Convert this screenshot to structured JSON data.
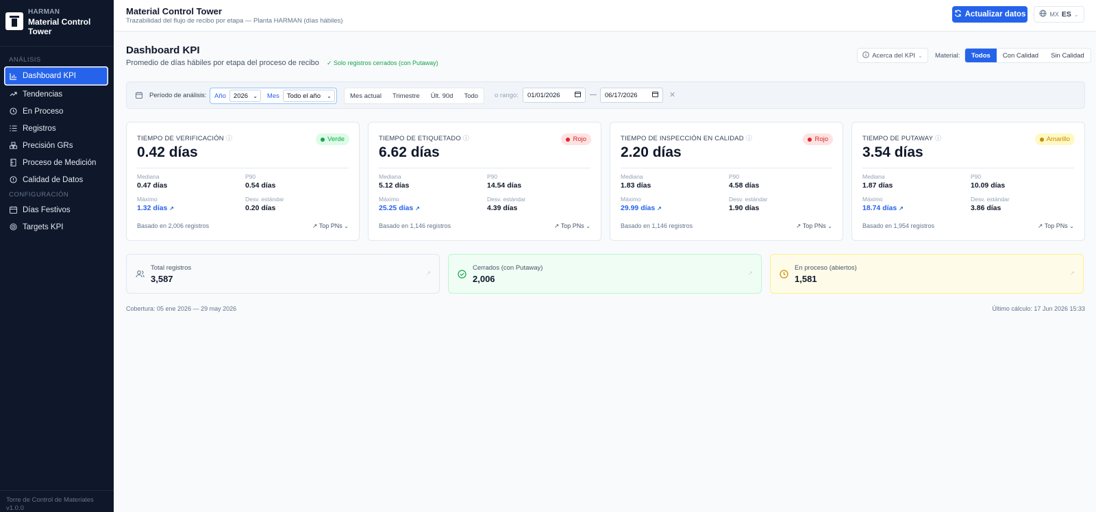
{
  "sidebar": {
    "org": "HARMAN",
    "app_line1": "Material Control",
    "app_line2": "Tower",
    "section_analysis": "ANÁLISIS",
    "section_config": "CONFIGURACIÓN",
    "items": [
      {
        "label": "Dashboard KPI",
        "icon": "bar-chart-icon"
      },
      {
        "label": "Tendencias",
        "icon": "trend-icon"
      },
      {
        "label": "En Proceso",
        "icon": "clock-icon"
      },
      {
        "label": "Registros",
        "icon": "list-icon"
      },
      {
        "label": "Precisión GRs",
        "icon": "boxes-icon"
      },
      {
        "label": "Proceso de Medición",
        "icon": "ruler-icon"
      },
      {
        "label": "Calidad de Datos",
        "icon": "alert-circle-icon"
      },
      {
        "label": "Días Festivos",
        "icon": "calendar-icon"
      },
      {
        "label": "Targets KPI",
        "icon": "target-icon"
      }
    ],
    "footer_line1": "Torre de Control de Materiales",
    "footer_line2": "v1.0.0"
  },
  "topbar": {
    "title": "Material Control Tower",
    "subtitle": "Trazabilidad del flujo de recibo por etapa — Planta HARMAN (días hábiles)",
    "refresh_label": "Actualizar datos",
    "lang_region": "MX",
    "lang_code": "ES"
  },
  "page": {
    "title": "Dashboard KPI",
    "subtitle": "Promedio de días hábiles por etapa del proceso de recibo",
    "closed_note": "✓ Solo registros cerrados (con Putaway)",
    "about_label": "Acerca del KPI",
    "material_label": "Material:",
    "material_options": [
      "Todos",
      "Con Calidad",
      "Sin Calidad"
    ]
  },
  "filter": {
    "period_label": "Período de análisis:",
    "year_label": "Año",
    "year_value": "2026",
    "month_label": "Mes",
    "month_value": "Todo el año",
    "quick_options": [
      "Mes actual",
      "Trimestre",
      "Últ. 90d",
      "Todo"
    ],
    "range_label": "o rango:",
    "date_from": "01/01/2026",
    "date_to": "06/17/2026",
    "range_sep": "—"
  },
  "kpis": [
    {
      "title": "TIEMPO DE VERIFICACIÓN",
      "value": "0.42 días",
      "status": "Verde",
      "status_color": "#16a34a",
      "status_bg": "#dcfce7",
      "median_label": "Mediana",
      "median": "0.47 días",
      "p90_label": "P90",
      "p90": "0.54 días",
      "max_label": "Máximo",
      "max": "1.32 días",
      "std_label": "Desv. estándar",
      "std": "0.20 días",
      "basis": "Basado en 2,006 registros",
      "top_label": "Top PNs"
    },
    {
      "title": "TIEMPO DE ETIQUETADO",
      "value": "6.62 días",
      "status": "Rojo",
      "status_color": "#dc2626",
      "status_bg": "#fee2e2",
      "median_label": "Mediana",
      "median": "5.12 días",
      "p90_label": "P90",
      "p90": "14.54 días",
      "max_label": "Máximo",
      "max": "25.25 días",
      "std_label": "Desv. estándar",
      "std": "4.39 días",
      "basis": "Basado en 1,146 registros",
      "top_label": "Top PNs"
    },
    {
      "title": "TIEMPO DE INSPECCIÓN EN CALIDAD",
      "value": "2.20 días",
      "status": "Rojo",
      "status_color": "#dc2626",
      "status_bg": "#fee2e2",
      "median_label": "Mediana",
      "median": "1.83 días",
      "p90_label": "P90",
      "p90": "4.58 días",
      "max_label": "Máximo",
      "max": "29.99 días",
      "std_label": "Desv. estándar",
      "std": "1.90 días",
      "basis": "Basado en 1,146 registros",
      "top_label": "Top PNs"
    },
    {
      "title": "TIEMPO DE PUTAWAY",
      "value": "3.54 días",
      "status": "Amarillo",
      "status_color": "#ca8a04",
      "status_bg": "#fef9c3",
      "median_label": "Mediana",
      "median": "1.87 días",
      "p90_label": "P90",
      "p90": "10.09 días",
      "max_label": "Máximo",
      "max": "18.74 días",
      "std_label": "Desv. estándar",
      "std": "3.86 días",
      "basis": "Basado en 1,954 registros",
      "top_label": "Top PNs"
    }
  ],
  "summary": [
    {
      "label": "Total registros",
      "value": "3,587",
      "icon": "users-icon",
      "color": "#64748b",
      "bg": "#f8fafc",
      "border": "#e2e8f0"
    },
    {
      "label": "Cerrados (con Putaway)",
      "value": "2,006",
      "icon": "check-circle-icon",
      "color": "#16a34a",
      "bg": "#f0fdf4",
      "border": "#bbf7d0"
    },
    {
      "label": "En proceso (abiertos)",
      "value": "1,581",
      "icon": "clock-icon",
      "color": "#ca8a04",
      "bg": "#fefce8",
      "border": "#fef08a"
    }
  ],
  "footer": {
    "coverage": "Cobertura: 05 ene 2026 — 29 may 2026",
    "last_calc": "Último cálculo: 17 Jun 2026 15:33"
  }
}
